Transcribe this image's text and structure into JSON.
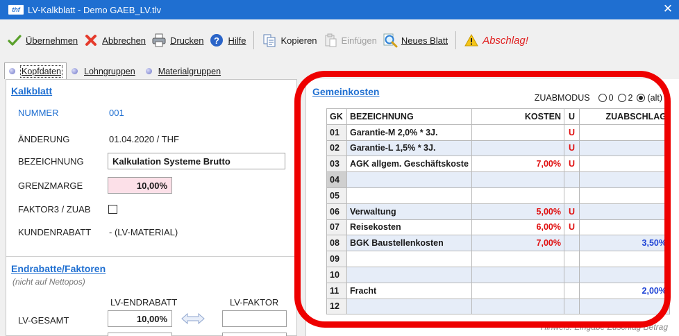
{
  "window": {
    "logo": "thf",
    "title": "LV-Kalkblatt - Demo GAEB_LV.tlv",
    "close": "✕"
  },
  "toolbar": {
    "uebernehmen": "Übernehmen",
    "abbrechen": "Abbrechen",
    "drucken": "Drucken",
    "hilfe": "Hilfe",
    "kopieren": "Kopieren",
    "einfuegen": "Einfügen",
    "neues_blatt": "Neues Blatt",
    "abschlag": "Abschlag!"
  },
  "tabs": [
    {
      "label": "Kopfdaten"
    },
    {
      "label": "Lohngruppen"
    },
    {
      "label": "Materialgruppen"
    }
  ],
  "kalkblatt": {
    "title": "Kalkblatt",
    "nummer_label": "NUMMER",
    "nummer_value": "001",
    "aenderung_label": "ÄNDERUNG",
    "aenderung_value": "01.04.2020 / THF",
    "bezeichnung_label": "BEZEICHNUNG",
    "bezeichnung_value": "Kalkulation Systeme Brutto",
    "grenzmarge_label": "GRENZMARGE",
    "grenzmarge_value": "10,00%",
    "faktor_label": "FAKTOR3 / ZUAB",
    "kundenrabatt_label": "KUNDENRABATT",
    "kundenrabatt_value": "- (LV-MATERIAL)"
  },
  "endrabatte": {
    "title": "Endrabatte/Faktoren",
    "hint": "(nicht auf Nettopos)",
    "col_endrabatt": "LV-ENDRABATT",
    "col_faktor": "LV-FAKTOR",
    "row_label": "LV-GESAMT",
    "endrabatt_value": "10,00%"
  },
  "gemeinkosten": {
    "title": "Gemeinkosten",
    "zuabmodus_label": "ZUABMODUS",
    "options": [
      "0",
      "2",
      "(alt)"
    ],
    "selected": "(alt)",
    "headers": {
      "gk": "GK",
      "bez": "BEZEICHNUNG",
      "kosten": "KOSTEN",
      "u": "U",
      "zua": "ZUABSCHLAG"
    },
    "rows": [
      {
        "gk": "01",
        "bez": "Garantie-M 2,0% * 3J.",
        "kosten": "",
        "u": "U",
        "zua": ""
      },
      {
        "gk": "02",
        "bez": "Garantie-L 1,5% * 3J.",
        "kosten": "",
        "u": "U",
        "zua": ""
      },
      {
        "gk": "03",
        "bez": "AGK allgem. Geschäftskoste",
        "kosten": "7,00%",
        "u": "U",
        "zua": ""
      },
      {
        "gk": "04",
        "bez": "",
        "kosten": "",
        "u": "",
        "zua": ""
      },
      {
        "gk": "05",
        "bez": "",
        "kosten": "",
        "u": "",
        "zua": ""
      },
      {
        "gk": "06",
        "bez": "Verwaltung",
        "kosten": "5,00%",
        "u": "U",
        "zua": ""
      },
      {
        "gk": "07",
        "bez": "Reisekosten",
        "kosten": "6,00%",
        "u": "U",
        "zua": ""
      },
      {
        "gk": "08",
        "bez": "BGK Baustellenkosten",
        "kosten": "7,00%",
        "u": "",
        "zua": "3,50%"
      },
      {
        "gk": "09",
        "bez": "",
        "kosten": "",
        "u": "",
        "zua": ""
      },
      {
        "gk": "10",
        "bez": "",
        "kosten": "",
        "u": "",
        "zua": ""
      },
      {
        "gk": "11",
        "bez": "Fracht",
        "kosten": "",
        "u": "",
        "zua": "2,00%"
      },
      {
        "gk": "12",
        "bez": "",
        "kosten": "",
        "u": "",
        "zua": ""
      }
    ],
    "bottom_hint": "Hinweis: Eingabe Zuschlag Betrag"
  },
  "colors": {
    "accent": "#1f6fd1",
    "red": "#e01010",
    "highlight": "#ee0000"
  }
}
